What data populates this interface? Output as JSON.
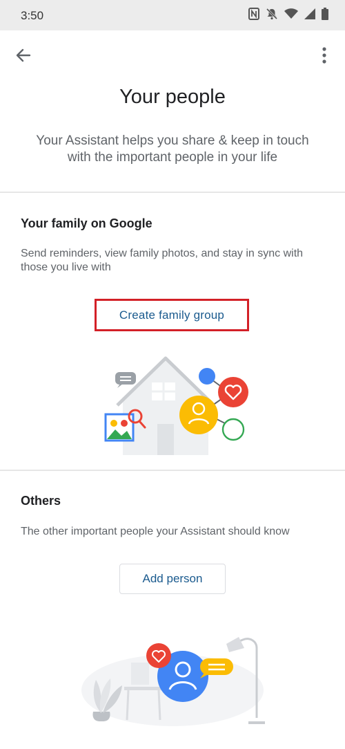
{
  "status_bar": {
    "time": "3:50"
  },
  "header": {
    "title": "Your people",
    "subtitle": "Your Assistant helps you share & keep in touch with the important people in your life"
  },
  "family": {
    "title": "Your family on Google",
    "description": "Send reminders, view family photos, and stay in sync with those you live with",
    "button_label": "Create family group"
  },
  "others": {
    "title": "Others",
    "description": "The other important people your Assistant should know",
    "button_label": "Add person"
  },
  "colors": {
    "link": "#1a5a8e",
    "highlight_border": "#d32027",
    "blue": "#4285f4",
    "red": "#ea4335",
    "yellow": "#fbbc04",
    "green": "#34a853"
  },
  "icons": [
    "nfc-icon",
    "notifications-off-icon",
    "wifi-icon",
    "signal-icon",
    "battery-icon",
    "back-arrow-icon",
    "more-vert-icon"
  ]
}
